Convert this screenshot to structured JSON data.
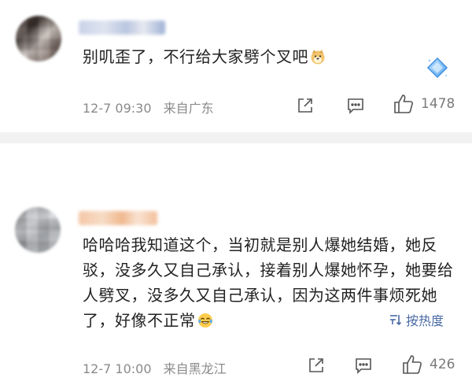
{
  "comments": [
    {
      "text": "别叽歪了，不行给大家劈个叉吧",
      "emoji": "doge-emoji",
      "date": "12-7 09:30",
      "location": "来自广东",
      "likes": "1478"
    },
    {
      "text": "哈哈哈我知道这个，当初就是别人爆她结婚，她反驳，没多久又自己承认，接着别人爆她怀孕，她要给人劈叉，没多久又自己承认，因为这两件事烦死她了，好像不正常",
      "emoji": "laugh-cry-emoji",
      "date": "12-7 10:00",
      "location": "来自黑龙江",
      "likes": "426"
    }
  ],
  "sort": {
    "label": "按热度",
    "icon": "sort-icon"
  },
  "colors": {
    "accent": "#4a6aa5",
    "meta_text": "#8a8a8a",
    "separator": "#f2f2f2"
  }
}
